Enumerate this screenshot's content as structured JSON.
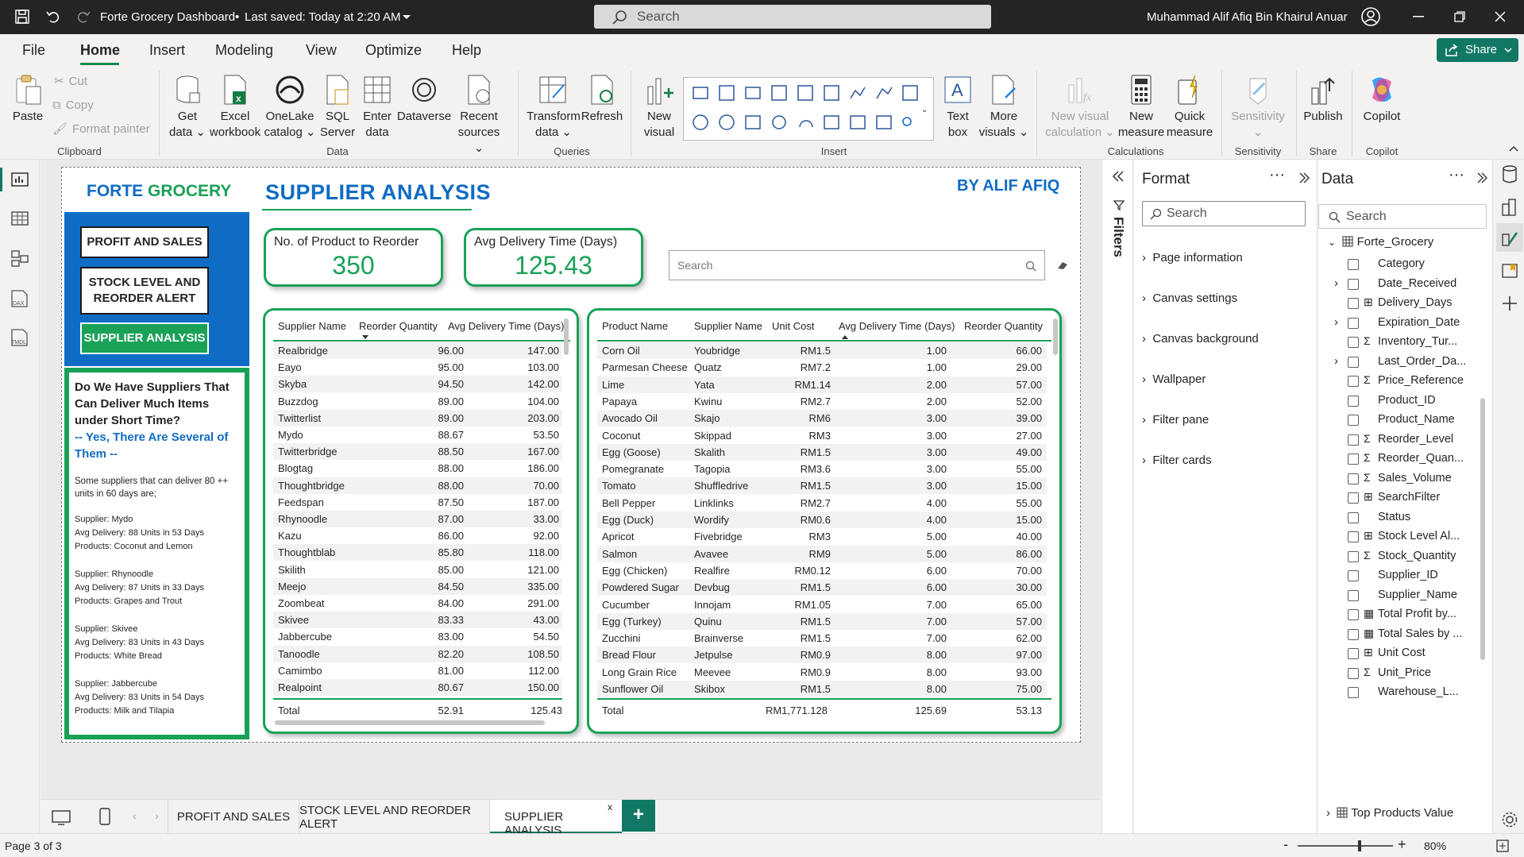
{
  "window": {
    "title": "Forte Grocery Dashboard",
    "saved": "Last saved: Today at 2:20 AM",
    "search_placeholder": "Search",
    "user": "Muhammad Alif Afiq Bin Khairul Anuar"
  },
  "menu": {
    "items": [
      "File",
      "Home",
      "Insert",
      "Modeling",
      "View",
      "Optimize",
      "Help"
    ],
    "active": "Home",
    "share": "Share"
  },
  "ribbon": {
    "paste": "Paste",
    "cut": "Cut",
    "copy": "Copy",
    "format_painter": "Format painter",
    "clipboard": "Clipboard",
    "get_data": [
      "Get",
      "data"
    ],
    "excel": [
      "Excel",
      "workbook"
    ],
    "onelake": [
      "OneLake",
      "catalog"
    ],
    "sql": [
      "SQL",
      "Server"
    ],
    "enter": [
      "Enter",
      "data"
    ],
    "dataverse": "Dataverse",
    "recent": [
      "Recent",
      "sources"
    ],
    "data_group": "Data",
    "transform": [
      "Transform",
      "data"
    ],
    "refresh": "Refresh",
    "queries": "Queries",
    "new_visual": [
      "New",
      "visual"
    ],
    "text_box": [
      "Text",
      "box"
    ],
    "more_visuals": [
      "More",
      "visuals"
    ],
    "insert": "Insert",
    "new_visual_calc": [
      "New visual",
      "calculation"
    ],
    "new_measure": [
      "New",
      "measure"
    ],
    "quick_measure": [
      "Quick",
      "measure"
    ],
    "calculations": "Calculations",
    "sensitivity": "Sensitivity",
    "sensitivity_group": "Sensitivity",
    "publish": "Publish",
    "share_group": "Share",
    "copilot": "Copilot",
    "copilot_group": "Copilot"
  },
  "report": {
    "brand": {
      "part1": "FORTE ",
      "part2": "GROCERY"
    },
    "page_title": "SUPPLIER ANALYSIS",
    "byline": "BY ALIF AFIQ",
    "nav": [
      "PROFIT AND SALES",
      "STOCK LEVEL AND\nREORDER ALERT",
      "SUPPLIER ANALYSIS"
    ],
    "insight": {
      "q": "Do We Have Suppliers That Can Deliver Much Items under Short Time?",
      "a": "-- Yes, There Are Several of Them --",
      "intro": "Some suppliers that can deliver 80 ++ units in 60 days are;",
      "entries": [
        [
          "Supplier: Mydo",
          "Avg Delivery: 88 Units in 53 Days",
          "Products: Coconut and Lemon"
        ],
        [
          "Supplier: Rhynoodle",
          "Avg Delivery: 87 Units in 33 Days",
          "Products: Grapes and Trout"
        ],
        [
          "Supplier: Skivee",
          "Avg Delivery: 83 Units in 43 Days",
          "Products: White Bread"
        ],
        [
          "Supplier:  Jabbercube",
          "Avg Delivery: 83 Units in 54 Days",
          "Products: Milk and Tilapia"
        ]
      ]
    },
    "kpi1": {
      "label": "No. of Product to Reorder",
      "value": "350"
    },
    "kpi2": {
      "label": "Avg Delivery Time (Days)",
      "value": "125.43"
    },
    "search": {
      "placeholder": "Search"
    },
    "table1": {
      "headers": [
        "Supplier Name",
        "Reorder Quantity",
        "Avg Delivery Time (Days)"
      ],
      "rows": [
        [
          "Realbridge",
          "96.00",
          "147.00"
        ],
        [
          "Eayo",
          "95.00",
          "103.00"
        ],
        [
          "Skyba",
          "94.50",
          "142.00"
        ],
        [
          "Buzzdog",
          "89.00",
          "104.00"
        ],
        [
          "Twitterlist",
          "89.00",
          "203.00"
        ],
        [
          "Mydo",
          "88.67",
          "53.50"
        ],
        [
          "Twitterbridge",
          "88.50",
          "167.00"
        ],
        [
          "Blogtag",
          "88.00",
          "186.00"
        ],
        [
          "Thoughtbridge",
          "88.00",
          "70.00"
        ],
        [
          "Feedspan",
          "87.50",
          "187.00"
        ],
        [
          "Rhynoodle",
          "87.00",
          "33.00"
        ],
        [
          "Kazu",
          "86.00",
          "92.00"
        ],
        [
          "Thoughtblab",
          "85.80",
          "118.00"
        ],
        [
          "Skilith",
          "85.00",
          "121.00"
        ],
        [
          "Meejo",
          "84.50",
          "335.00"
        ],
        [
          "Zoombeat",
          "84.00",
          "291.00"
        ],
        [
          "Skivee",
          "83.33",
          "43.00"
        ],
        [
          "Jabbercube",
          "83.00",
          "54.50"
        ],
        [
          "Tanoodle",
          "82.20",
          "108.50"
        ],
        [
          "Camimbo",
          "81.00",
          "112.00"
        ],
        [
          "Realpoint",
          "80.67",
          "150.00"
        ]
      ],
      "total": [
        "Total",
        "52.91",
        "125.43"
      ]
    },
    "table2": {
      "headers": [
        "Product Name",
        "Supplier Name",
        "Unit Cost",
        "Avg Delivery Time (Days)",
        "Reorder Quantity"
      ],
      "rows": [
        [
          "Corn Oil",
          "Youbridge",
          "RM1.5",
          "1.00",
          "66.00"
        ],
        [
          "Parmesan Cheese",
          "Quatz",
          "RM7.2",
          "1.00",
          "29.00"
        ],
        [
          "Lime",
          "Yata",
          "RM1.14",
          "2.00",
          "57.00"
        ],
        [
          "Papaya",
          "Kwinu",
          "RM2.7",
          "2.00",
          "52.00"
        ],
        [
          "Avocado Oil",
          "Skajo",
          "RM6",
          "3.00",
          "39.00"
        ],
        [
          "Coconut",
          "Skippad",
          "RM3",
          "3.00",
          "27.00"
        ],
        [
          "Egg (Goose)",
          "Skalith",
          "RM1.5",
          "3.00",
          "49.00"
        ],
        [
          "Pomegranate",
          "Tagopia",
          "RM3.6",
          "3.00",
          "55.00"
        ],
        [
          "Tomato",
          "Shuffledrive",
          "RM1.5",
          "3.00",
          "15.00"
        ],
        [
          "Bell Pepper",
          "Linklinks",
          "RM2.7",
          "4.00",
          "55.00"
        ],
        [
          "Egg (Duck)",
          "Wordify",
          "RM0.6",
          "4.00",
          "15.00"
        ],
        [
          "Apricot",
          "Fivebridge",
          "RM3",
          "5.00",
          "40.00"
        ],
        [
          "Salmon",
          "Avavee",
          "RM9",
          "5.00",
          "86.00"
        ],
        [
          "Egg (Chicken)",
          "Realfire",
          "RM0.12",
          "6.00",
          "70.00"
        ],
        [
          "Powdered Sugar",
          "Devbug",
          "RM1.5",
          "6.00",
          "30.00"
        ],
        [
          "Cucumber",
          "Innojam",
          "RM1.05",
          "7.00",
          "65.00"
        ],
        [
          "Egg (Turkey)",
          "Quinu",
          "RM1.5",
          "7.00",
          "57.00"
        ],
        [
          "Zucchini",
          "Brainverse",
          "RM1.5",
          "7.00",
          "62.00"
        ],
        [
          "Bread Flour",
          "Jetpulse",
          "RM0.9",
          "8.00",
          "97.00"
        ],
        [
          "Long Grain Rice",
          "Meevee",
          "RM0.9",
          "8.00",
          "93.00"
        ],
        [
          "Sunflower Oil",
          "Skibox",
          "RM1.5",
          "8.00",
          "75.00"
        ]
      ],
      "total": [
        "Total",
        "",
        "RM1,771.128",
        "125.69",
        "53.13"
      ]
    }
  },
  "filters": {
    "label": "Filters"
  },
  "format_pane": {
    "title": "Format",
    "search": "Search",
    "sections": [
      "Page information",
      "Canvas settings",
      "Canvas background",
      "Wallpaper",
      "Filter pane",
      "Filter cards"
    ]
  },
  "data_pane": {
    "title": "Data",
    "search": "Search",
    "table": "Forte_Grocery",
    "fields": [
      {
        "name": "Category",
        "type": "none",
        "exp": false
      },
      {
        "name": "Date_Received",
        "type": "none",
        "exp": true
      },
      {
        "name": "Delivery_Days",
        "type": "calc",
        "exp": false
      },
      {
        "name": "Expiration_Date",
        "type": "none",
        "exp": true
      },
      {
        "name": "Inventory_Tur...",
        "type": "sigma",
        "exp": false
      },
      {
        "name": "Last_Order_Da...",
        "type": "none",
        "exp": true
      },
      {
        "name": "Price_Reference",
        "type": "sigma",
        "exp": false
      },
      {
        "name": "Product_ID",
        "type": "none",
        "exp": false
      },
      {
        "name": "Product_Name",
        "type": "none",
        "exp": false
      },
      {
        "name": "Reorder_Level",
        "type": "sigma",
        "exp": false
      },
      {
        "name": "Reorder_Quan...",
        "type": "sigma",
        "exp": false
      },
      {
        "name": "Sales_Volume",
        "type": "sigma",
        "exp": false
      },
      {
        "name": "SearchFilter",
        "type": "calc",
        "exp": false
      },
      {
        "name": "Status",
        "type": "none",
        "exp": false
      },
      {
        "name": "Stock Level Al...",
        "type": "calc",
        "exp": false
      },
      {
        "name": "Stock_Quantity",
        "type": "sigma",
        "exp": false
      },
      {
        "name": "Supplier_ID",
        "type": "none",
        "exp": false
      },
      {
        "name": "Supplier_Name",
        "type": "none",
        "exp": false
      },
      {
        "name": "Total Profit by...",
        "type": "measure",
        "exp": false
      },
      {
        "name": "Total Sales by ...",
        "type": "measure",
        "exp": false
      },
      {
        "name": "Unit Cost",
        "type": "calc",
        "exp": false
      },
      {
        "name": "Unit_Price",
        "type": "sigma",
        "exp": false
      },
      {
        "name": "Warehouse_L...",
        "type": "none",
        "exp": false
      }
    ],
    "other_table": "Top Products Value"
  },
  "tabs": {
    "items": [
      "PROFIT AND SALES",
      "STOCK LEVEL AND REORDER ALERT",
      "SUPPLIER ANALYSIS"
    ],
    "active": "SUPPLIER ANALYSIS",
    "close": "x",
    "add": "+"
  },
  "status": {
    "page": "Page 3 of 3",
    "zoom": "80%",
    "minus": "-",
    "plus": "+"
  },
  "colors": {
    "green": "#1aa158",
    "blue": "#0f62c8",
    "navbg": "#0f6cc4",
    "brandblue": "#0f6cc4"
  }
}
